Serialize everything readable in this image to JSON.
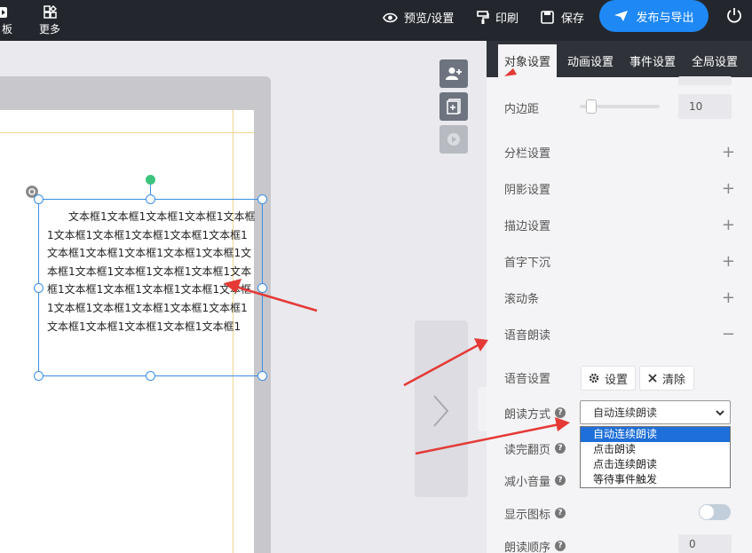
{
  "topbar": {
    "left_items": [
      {
        "label": "板",
        "icon": "template-icon"
      },
      {
        "label": "更多",
        "icon": "more-icon"
      }
    ],
    "preview_label": "预览/设置",
    "print_label": "印刷",
    "save_label": "保存",
    "publish_label": "发布与导出"
  },
  "textbox": {
    "content": "文本框1文本框1文本框1文本框1文本框1文本框1文本框1文本框1文本框1文本框1文本框1文本框1文本框1文本框1文本框1文本框1文本框1文本框1文本框1文本框1文本框1文本框1文本框1文本框1文本框1文本框1文本框1文本框1文本框1文本框1文本框1文本框1文本框1文本框1文本框1文本框1"
  },
  "panel": {
    "tabs": [
      "对象设置",
      "动画设置",
      "事件设置",
      "全局设置"
    ],
    "active_tab": "对象设置",
    "padding_label": "内边距",
    "padding_value": "10",
    "sections": [
      "分栏设置",
      "阴影设置",
      "描边设置",
      "首字下沉",
      "滚动条",
      "语音朗读"
    ],
    "voice": {
      "voice_settings_label": "语音设置",
      "settings_btn": "设置",
      "clear_btn": "清除",
      "read_mode_label": "朗读方式",
      "read_mode_value": "自动连续朗读",
      "read_mode_options": [
        "自动连续朗读",
        "点击朗读",
        "点击连续朗读",
        "等待事件触发"
      ],
      "turn_page_label": "读完翻页",
      "lower_volume_label": "减小音量",
      "show_icon_label": "显示图标",
      "read_order_label": "朗读顺序",
      "read_order_value": "0"
    }
  },
  "colors": {
    "accent": "#1e88f5",
    "annotation": "#e53935"
  }
}
